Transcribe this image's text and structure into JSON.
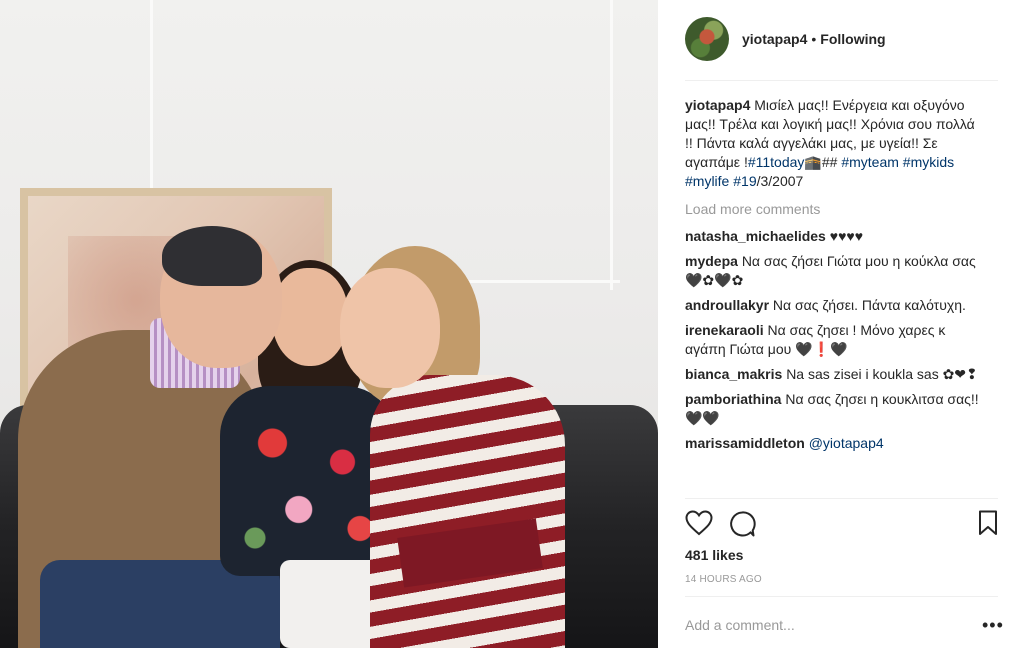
{
  "header": {
    "username": "yiotapap4",
    "separator": "•",
    "follow_status": "Following"
  },
  "caption": {
    "username": "yiotapap4",
    "text": "Μισίελ μας!! Ενέργεια και οξυγόνο μας!! Τρέλα και λογική μας!! Χρόνια σου πολλά !! Πάντα καλά αγγελάκι μας, με υγεία!! Σε αγαπάμε !",
    "tag_1": "#11today",
    "emoji_1": "🕋",
    "text_2": "## ",
    "tag_2": "#myteam",
    "tag_3": "#mykids",
    "tag_4": "#mylife",
    "tag_5": "#19",
    "text_3": "/3/2007"
  },
  "load_more": "Load more comments",
  "comments": [
    {
      "username": "natasha_michaelides",
      "text": "♥♥♥♥"
    },
    {
      "username": "mydepa",
      "text": "Να σας ζήσει Γιώτα μου η κούκλα σας 🖤✿🖤✿"
    },
    {
      "username": "androullakyr",
      "text": "Να σας ζήσει. Πάντα καλότυχη."
    },
    {
      "username": "irenekaraoli",
      "text": "Να σας ζησει ! Μόνο χαρες κ αγάπη Γιώτα μου 🖤❗🖤"
    },
    {
      "username": "bianca_makris",
      "text": "Na sas zisei i koukla sas ✿❤︎❢"
    },
    {
      "username": "pamboriathina",
      "text": "Να σας ζησει η κουκλιτσα σας!! 🖤🖤"
    },
    {
      "username": "marissamiddleton",
      "mention": "@yiotapap4"
    }
  ],
  "likes": "481 likes",
  "timestamp": "14 HOURS AGO",
  "add_comment_placeholder": "Add a comment...",
  "more_options": "•••",
  "icons": [
    "heart-icon",
    "comment-icon",
    "bookmark-icon",
    "more-options-icon"
  ]
}
